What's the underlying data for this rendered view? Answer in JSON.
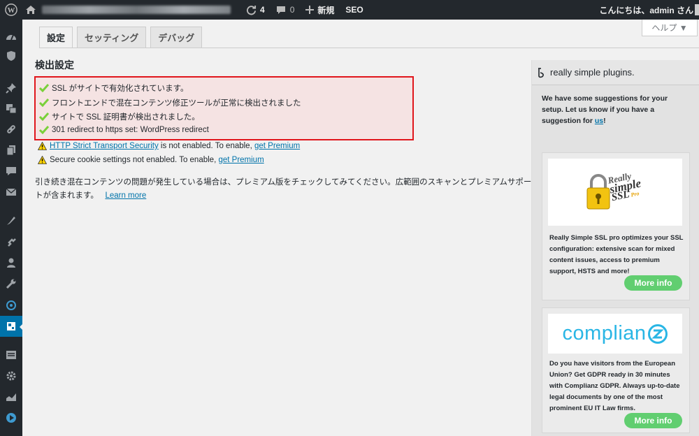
{
  "adminbar": {
    "updates_count": "4",
    "comments_count": "0",
    "new_label": "新規",
    "seo_label": "SEO",
    "greeting": "こんにちは、admin さん"
  },
  "tabs": [
    {
      "label": "設定"
    },
    {
      "label": "セッティング"
    },
    {
      "label": "デバッグ"
    }
  ],
  "help_button": "ヘルプ ▼",
  "section_title": "検出設定",
  "status_items": [
    "SSL がサイトで有効化されています。",
    "フロントエンドで混在コンテンツ修正ツールが正常に検出されました",
    "サイトで SSL 証明書が検出されました。",
    "301 redirect to https set: WordPress redirect"
  ],
  "warnings": [
    {
      "link": "HTTP Strict Transport Security",
      "text": " is not enabled. To enable, ",
      "cta": "get Premium"
    },
    {
      "link": "",
      "text": "Secure cookie settings not enabled. To enable, ",
      "cta": "get Premium"
    }
  ],
  "info_text": "引き続き混在コンテンツの問題が発生している場合は、プレミアム版をチェックしてみてください。広範囲のスキャンとプレミアムサポートが含まれます。",
  "info_link": "Learn more",
  "panel": {
    "title": "really simple plugins.",
    "intro_text": "We have some suggestions for your setup. Let us know if you have a suggestion for ",
    "intro_link": "us",
    "intro_end": "!",
    "promos": [
      {
        "logo_text": [
          "Really",
          "simple",
          "SSL",
          "Pro"
        ],
        "text": "Really Simple SSL pro optimizes your SSL configuration: extensive scan for mixed content issues, access to premium support, HSTS and more!",
        "button": "More info"
      },
      {
        "logo_text": [
          "complian"
        ],
        "text": "Do you have visitors from the European Union? Get GDPR ready in 30 minutes with Complianz GDPR. Always up-to-date legal documents by one of the most prominent EU IT Law firms.",
        "button": "More info"
      }
    ]
  },
  "colors": {
    "adminbar_bg": "#23282d",
    "active_menu": "#0073aa",
    "highlight_border": "#e0161c",
    "highlight_bg": "#f5e3e3",
    "check": "#7ad03a",
    "button_green": "#61ce70",
    "complianz_blue": "#29b6e5"
  }
}
